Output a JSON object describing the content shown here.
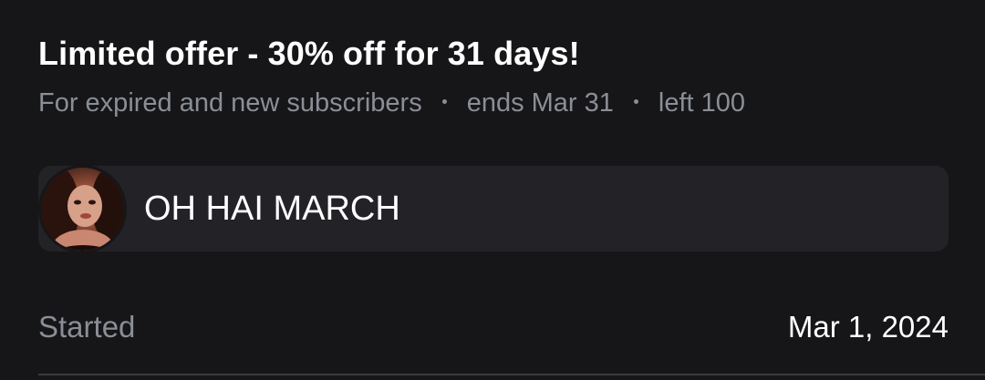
{
  "offer": {
    "title": "Limited offer - 30% off for 31 days!",
    "audience": "For expired and new subscribers",
    "ends": "ends Mar 31",
    "remaining": "left 100"
  },
  "promo": {
    "message": "OH HAI MARCH",
    "avatar_icon": "user-avatar"
  },
  "details": {
    "started_label": "Started",
    "started_value": "Mar 1, 2024"
  },
  "colors": {
    "background": "#161618",
    "card": "#232327",
    "primary_text": "#ffffff",
    "secondary_text": "#8a8e96"
  }
}
